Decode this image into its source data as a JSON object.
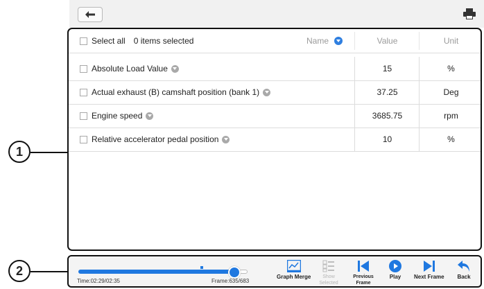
{
  "header": {
    "back_icon": "back-arrow-icon",
    "print_icon": "printer-icon"
  },
  "table": {
    "select_all_label": "Select all",
    "selected_count": "0 items selected",
    "sort_label": "Name",
    "columns": {
      "value": "Value",
      "unit": "Unit"
    },
    "rows": [
      {
        "name": "Absolute Load Value",
        "value": "15",
        "unit": "%"
      },
      {
        "name": "Actual exhaust (B) camshaft position (bank 1)",
        "value": "37.25",
        "unit": "Deg"
      },
      {
        "name": "Engine speed",
        "value": "3685.75",
        "unit": "rpm"
      },
      {
        "name": "Relative accelerator pedal position",
        "value": "10",
        "unit": "%"
      }
    ]
  },
  "callouts": {
    "one": "1",
    "two": "2"
  },
  "playback": {
    "time": "Time:02:29/02:35",
    "frame": "Frame:635/683",
    "progress_fraction": 0.93
  },
  "toolbar": {
    "graph_merge": "Graph Merge",
    "show_selected": "Show Selected",
    "previous_frame": "Previous Frame",
    "play": "Play",
    "next_frame": "Next Frame",
    "back": "Back"
  },
  "colors": {
    "accent": "#1f78e0",
    "border": "#111111"
  }
}
